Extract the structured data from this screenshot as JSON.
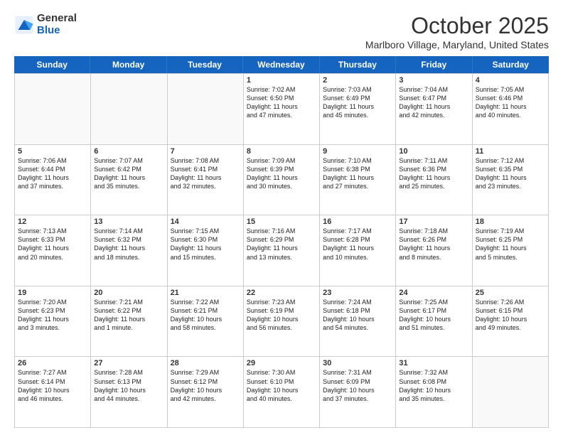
{
  "logo": {
    "general": "General",
    "blue": "Blue"
  },
  "header": {
    "month": "October 2025",
    "location": "Marlboro Village, Maryland, United States"
  },
  "weekdays": [
    "Sunday",
    "Monday",
    "Tuesday",
    "Wednesday",
    "Thursday",
    "Friday",
    "Saturday"
  ],
  "weeks": [
    [
      {
        "day": "",
        "info": ""
      },
      {
        "day": "",
        "info": ""
      },
      {
        "day": "",
        "info": ""
      },
      {
        "day": "1",
        "info": "Sunrise: 7:02 AM\nSunset: 6:50 PM\nDaylight: 11 hours\nand 47 minutes."
      },
      {
        "day": "2",
        "info": "Sunrise: 7:03 AM\nSunset: 6:49 PM\nDaylight: 11 hours\nand 45 minutes."
      },
      {
        "day": "3",
        "info": "Sunrise: 7:04 AM\nSunset: 6:47 PM\nDaylight: 11 hours\nand 42 minutes."
      },
      {
        "day": "4",
        "info": "Sunrise: 7:05 AM\nSunset: 6:46 PM\nDaylight: 11 hours\nand 40 minutes."
      }
    ],
    [
      {
        "day": "5",
        "info": "Sunrise: 7:06 AM\nSunset: 6:44 PM\nDaylight: 11 hours\nand 37 minutes."
      },
      {
        "day": "6",
        "info": "Sunrise: 7:07 AM\nSunset: 6:42 PM\nDaylight: 11 hours\nand 35 minutes."
      },
      {
        "day": "7",
        "info": "Sunrise: 7:08 AM\nSunset: 6:41 PM\nDaylight: 11 hours\nand 32 minutes."
      },
      {
        "day": "8",
        "info": "Sunrise: 7:09 AM\nSunset: 6:39 PM\nDaylight: 11 hours\nand 30 minutes."
      },
      {
        "day": "9",
        "info": "Sunrise: 7:10 AM\nSunset: 6:38 PM\nDaylight: 11 hours\nand 27 minutes."
      },
      {
        "day": "10",
        "info": "Sunrise: 7:11 AM\nSunset: 6:36 PM\nDaylight: 11 hours\nand 25 minutes."
      },
      {
        "day": "11",
        "info": "Sunrise: 7:12 AM\nSunset: 6:35 PM\nDaylight: 11 hours\nand 23 minutes."
      }
    ],
    [
      {
        "day": "12",
        "info": "Sunrise: 7:13 AM\nSunset: 6:33 PM\nDaylight: 11 hours\nand 20 minutes."
      },
      {
        "day": "13",
        "info": "Sunrise: 7:14 AM\nSunset: 6:32 PM\nDaylight: 11 hours\nand 18 minutes."
      },
      {
        "day": "14",
        "info": "Sunrise: 7:15 AM\nSunset: 6:30 PM\nDaylight: 11 hours\nand 15 minutes."
      },
      {
        "day": "15",
        "info": "Sunrise: 7:16 AM\nSunset: 6:29 PM\nDaylight: 11 hours\nand 13 minutes."
      },
      {
        "day": "16",
        "info": "Sunrise: 7:17 AM\nSunset: 6:28 PM\nDaylight: 11 hours\nand 10 minutes."
      },
      {
        "day": "17",
        "info": "Sunrise: 7:18 AM\nSunset: 6:26 PM\nDaylight: 11 hours\nand 8 minutes."
      },
      {
        "day": "18",
        "info": "Sunrise: 7:19 AM\nSunset: 6:25 PM\nDaylight: 11 hours\nand 5 minutes."
      }
    ],
    [
      {
        "day": "19",
        "info": "Sunrise: 7:20 AM\nSunset: 6:23 PM\nDaylight: 11 hours\nand 3 minutes."
      },
      {
        "day": "20",
        "info": "Sunrise: 7:21 AM\nSunset: 6:22 PM\nDaylight: 11 hours\nand 1 minute."
      },
      {
        "day": "21",
        "info": "Sunrise: 7:22 AM\nSunset: 6:21 PM\nDaylight: 10 hours\nand 58 minutes."
      },
      {
        "day": "22",
        "info": "Sunrise: 7:23 AM\nSunset: 6:19 PM\nDaylight: 10 hours\nand 56 minutes."
      },
      {
        "day": "23",
        "info": "Sunrise: 7:24 AM\nSunset: 6:18 PM\nDaylight: 10 hours\nand 54 minutes."
      },
      {
        "day": "24",
        "info": "Sunrise: 7:25 AM\nSunset: 6:17 PM\nDaylight: 10 hours\nand 51 minutes."
      },
      {
        "day": "25",
        "info": "Sunrise: 7:26 AM\nSunset: 6:15 PM\nDaylight: 10 hours\nand 49 minutes."
      }
    ],
    [
      {
        "day": "26",
        "info": "Sunrise: 7:27 AM\nSunset: 6:14 PM\nDaylight: 10 hours\nand 46 minutes."
      },
      {
        "day": "27",
        "info": "Sunrise: 7:28 AM\nSunset: 6:13 PM\nDaylight: 10 hours\nand 44 minutes."
      },
      {
        "day": "28",
        "info": "Sunrise: 7:29 AM\nSunset: 6:12 PM\nDaylight: 10 hours\nand 42 minutes."
      },
      {
        "day": "29",
        "info": "Sunrise: 7:30 AM\nSunset: 6:10 PM\nDaylight: 10 hours\nand 40 minutes."
      },
      {
        "day": "30",
        "info": "Sunrise: 7:31 AM\nSunset: 6:09 PM\nDaylight: 10 hours\nand 37 minutes."
      },
      {
        "day": "31",
        "info": "Sunrise: 7:32 AM\nSunset: 6:08 PM\nDaylight: 10 hours\nand 35 minutes."
      },
      {
        "day": "",
        "info": ""
      }
    ]
  ]
}
